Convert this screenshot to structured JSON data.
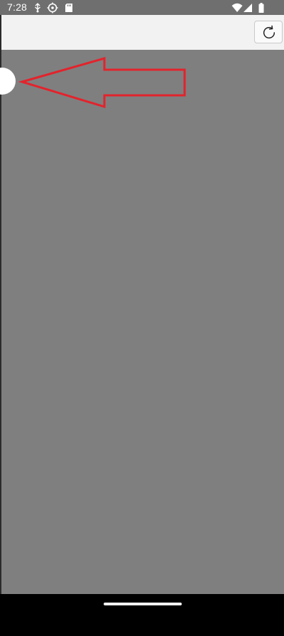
{
  "status_bar": {
    "time": "7:28",
    "left_icons": [
      "usb-debug-icon",
      "crosshair-icon",
      "sd-card-icon"
    ],
    "right_icons": [
      "wifi-icon",
      "cellular-icon",
      "battery-icon"
    ]
  },
  "top_bar": {
    "refresh_icon": "refresh-icon"
  },
  "content": {
    "annotation": "arrow-outline-icon"
  },
  "colors": {
    "status_bar": "#6f6f6f",
    "top_bar": "#f2f2f2",
    "content_bg": "#7f7f7f",
    "annotation_red": "#e3232c",
    "nav_bar": "#000000"
  }
}
